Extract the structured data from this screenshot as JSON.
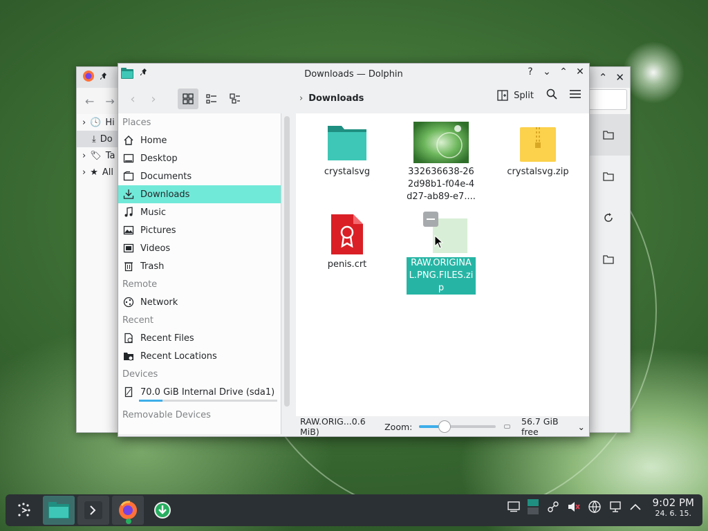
{
  "dolphin": {
    "title": "Downloads — Dolphin",
    "breadcrumb": "Downloads",
    "split_label": "Split",
    "places": [
      {
        "section": "Places"
      },
      {
        "label": "Home",
        "icon": "home-icon"
      },
      {
        "label": "Desktop",
        "icon": "desktop-icon"
      },
      {
        "label": "Documents",
        "icon": "documents-icon"
      },
      {
        "label": "Downloads",
        "icon": "download-icon",
        "selected": true
      },
      {
        "label": "Music",
        "icon": "music-icon"
      },
      {
        "label": "Pictures",
        "icon": "pictures-icon"
      },
      {
        "label": "Videos",
        "icon": "videos-icon"
      },
      {
        "label": "Trash",
        "icon": "trash-icon"
      },
      {
        "section": "Remote"
      },
      {
        "label": "Network",
        "icon": "network-icon"
      },
      {
        "section": "Recent"
      },
      {
        "label": "Recent Files",
        "icon": "recent-files-icon"
      },
      {
        "label": "Recent Locations",
        "icon": "recent-locations-icon"
      },
      {
        "section": "Devices"
      },
      {
        "label": "70.0 GiB Internal Drive (sda1)",
        "icon": "drive-icon",
        "usage": 0.17
      },
      {
        "section": "Removable Devices"
      }
    ],
    "files": [
      {
        "name": "crystalsvg",
        "type": "folder"
      },
      {
        "name": "332636638-262d98b1-f04e-4d27-ab89-e7....png",
        "type": "image"
      },
      {
        "name": "crystalsvg.zip",
        "type": "zip"
      },
      {
        "name": "penis.crt",
        "type": "certificate"
      },
      {
        "name": "RAW.ORIGINAL.PNG.FILES.zip",
        "type": "zip-dragging",
        "selected": true
      }
    ],
    "status": {
      "selection": "RAW.ORIG...0.6 MiB)",
      "zoom_label": "Zoom:",
      "free_space": "56.7 GiB free"
    }
  },
  "background_window": {
    "sidebar_items": [
      "Hi",
      "Do",
      "Ta",
      "All"
    ]
  },
  "taskbar": {
    "time": "9:02 PM",
    "date": "24. 6. 15."
  }
}
